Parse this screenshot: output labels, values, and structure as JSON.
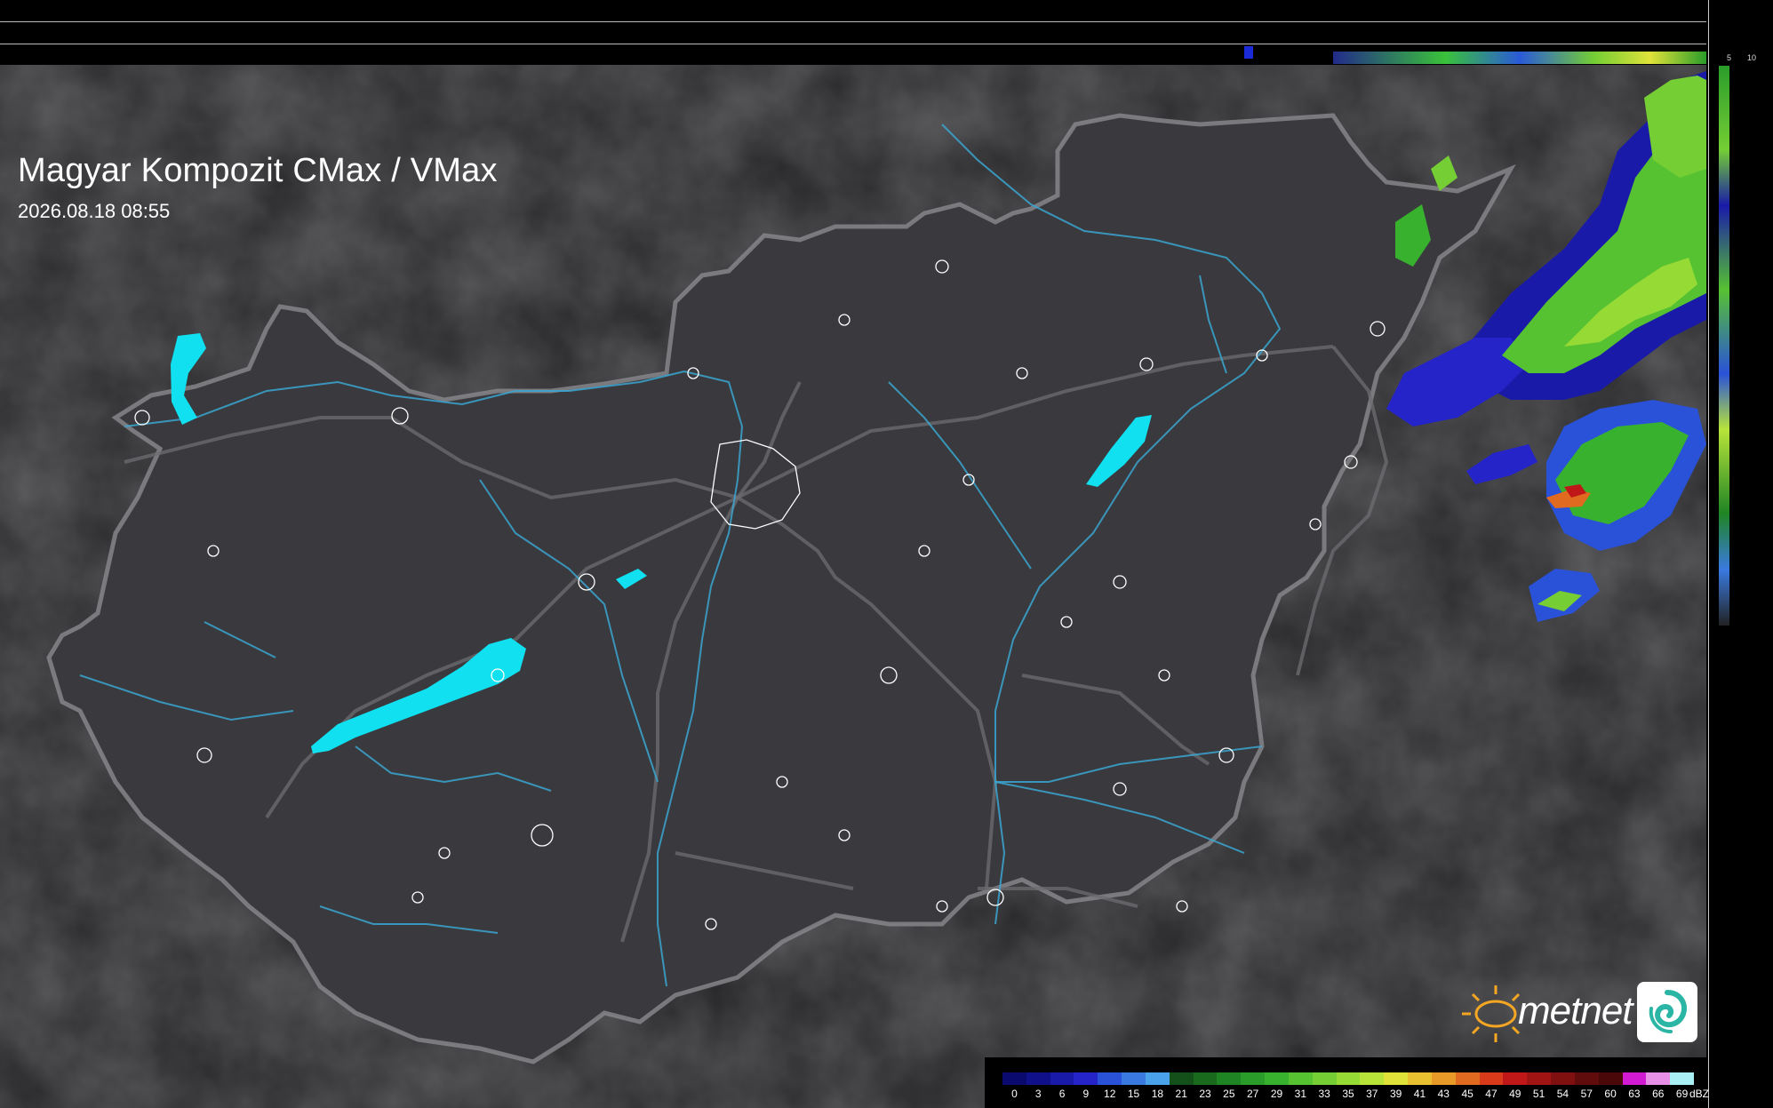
{
  "title": "Magyar Kompozit CMax / VMax",
  "datetime": "2026.08.18 08:55",
  "scale_ticks": {
    "top": [
      "10",
      "5"
    ],
    "side": [
      "5",
      "10"
    ]
  },
  "legend": {
    "unit": "dBZ",
    "values": [
      "0",
      "3",
      "6",
      "9",
      "12",
      "15",
      "18",
      "21",
      "23",
      "25",
      "27",
      "29",
      "31",
      "33",
      "35",
      "37",
      "39",
      "41",
      "43",
      "45",
      "47",
      "49",
      "51",
      "54",
      "57",
      "60",
      "63",
      "66",
      "69"
    ],
    "colors": [
      "#0a0a6e",
      "#10108a",
      "#1a1aa8",
      "#2424c8",
      "#2a52d8",
      "#3a7ae0",
      "#4aa2ea",
      "#14501a",
      "#1a6a1e",
      "#1f8424",
      "#2a9c2a",
      "#38b22e",
      "#56c232",
      "#74ce34",
      "#96da36",
      "#b8e43a",
      "#e0e23a",
      "#e8c030",
      "#e89a28",
      "#e06a20",
      "#d83a1a",
      "#c01818",
      "#a01414",
      "#801010",
      "#600c0c",
      "#4a0808",
      "#d21ad2",
      "#e890e8",
      "#a8f0f4"
    ]
  },
  "logo": {
    "text": "metnet"
  },
  "colors": {
    "map_bg": "#2a2a2c",
    "country_fill": "#3a3a3e",
    "border": "#8a8a8e",
    "rivers": "#3aa6d0",
    "lakes": "#11e0f0",
    "towns": "#ffffff"
  }
}
